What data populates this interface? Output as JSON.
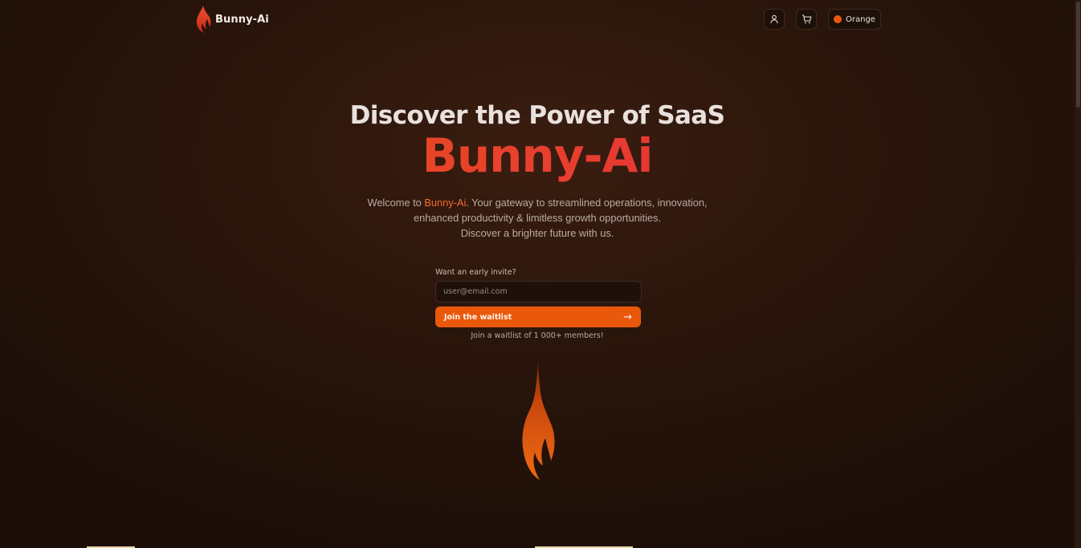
{
  "header": {
    "brand": "Bunny-Ai",
    "theme_label": "Orange",
    "theme_color": "#ea580c"
  },
  "hero": {
    "title": "Discover the Power of SaaS",
    "brand": "Bunny-Ai",
    "desc_prefix": "Welcome to ",
    "desc_brand": "Bunny-Ai",
    "desc_after": ". Your gateway to streamlined operations, innovation,",
    "desc_line2": "enhanced productivity & limitless growth opportunities.",
    "desc_line3": "Discover a brighter future with us."
  },
  "waitlist": {
    "label": "Want an early invite?",
    "placeholder": "user@email.com",
    "button_label": "Join the waitlist",
    "arrow": "→",
    "note": "Join a waitlist of 1 000+ members!"
  },
  "colors": {
    "accent": "#ea580c",
    "accent_alt": "#e11d48",
    "background": "#24130a"
  },
  "icons": [
    "flame-logo-icon",
    "user-icon",
    "cart-icon",
    "arrow-right-icon",
    "flame-icon"
  ]
}
